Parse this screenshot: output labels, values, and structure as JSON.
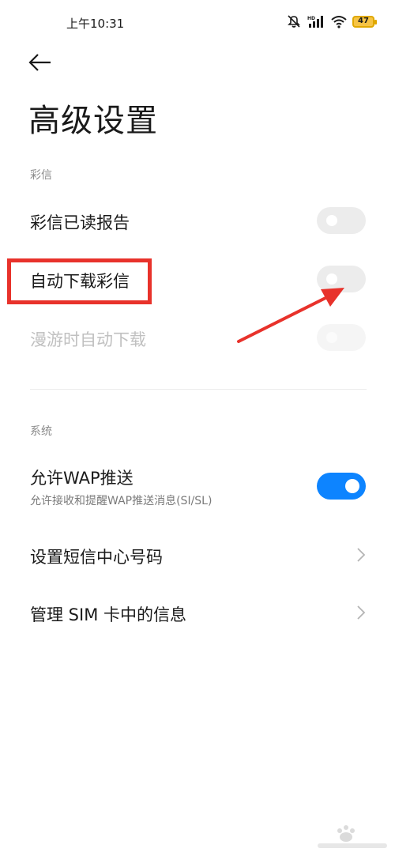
{
  "status_bar": {
    "time": "上午10:31",
    "icons": [
      "mute-icon",
      "signal-icon",
      "wifi-icon"
    ],
    "signal_badge": "HD",
    "battery_level": "47"
  },
  "header": {
    "back_icon": "back-arrow-icon",
    "title": "高级设置"
  },
  "sections": {
    "mms": {
      "header": "彩信",
      "items": [
        {
          "label": "彩信已读报告",
          "toggle": "off",
          "enabled": true
        },
        {
          "label": "自动下载彩信",
          "toggle": "off",
          "enabled": true
        },
        {
          "label": "漫游时自动下载",
          "toggle": "off",
          "enabled": false
        }
      ]
    },
    "system": {
      "header": "系统",
      "items": [
        {
          "label": "允许WAP推送",
          "sublabel": "允许接收和提醒WAP推送消息(SI/SL)",
          "toggle": "on"
        },
        {
          "label": "设置短信中心号码",
          "icon": "chevron-right-icon"
        },
        {
          "label": "管理 SIM 卡中的信息",
          "icon": "chevron-right-icon"
        }
      ]
    }
  },
  "annotation": {
    "highlight_color": "#e8322b",
    "arrow_color": "#e8322b"
  },
  "colors": {
    "accent": "#0d84ff",
    "toggle_off": "#ececec"
  }
}
